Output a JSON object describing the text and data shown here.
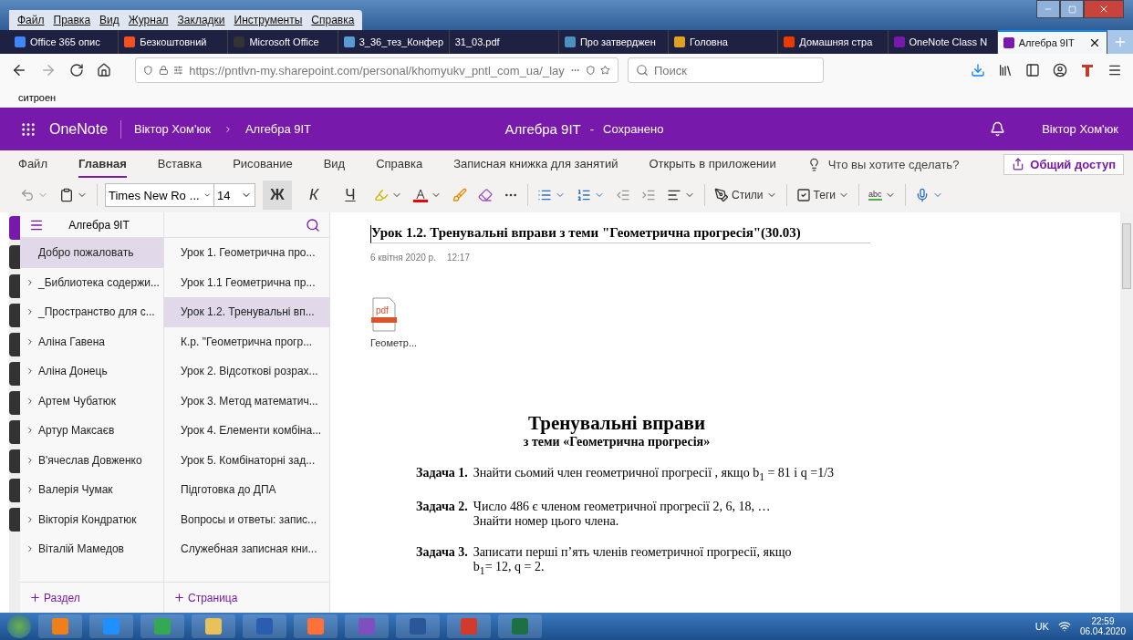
{
  "menu_bar": [
    "Файл",
    "Правка",
    "Вид",
    "Журнал",
    "Закладки",
    "Инструменты",
    "Справка"
  ],
  "browser_tabs": [
    {
      "title": "Office 365 опис",
      "selected": false,
      "color": "#4285f4"
    },
    {
      "title": "Безкоштовний",
      "selected": false,
      "color": "#f25022"
    },
    {
      "title": "Microsoft Office",
      "selected": false,
      "color": "#333333"
    },
    {
      "title": "3_36_тез_Конфер",
      "selected": false,
      "color": "#5b9bd5"
    },
    {
      "title": "31_03.pdf",
      "selected": false
    },
    {
      "title": "Про затверджен",
      "selected": false,
      "color": "#4a90c0"
    },
    {
      "title": "Головна",
      "selected": false,
      "color": "#e0a020"
    },
    {
      "title": "Домашняя стра",
      "selected": false,
      "color": "#eb3c00"
    },
    {
      "title": "OneNote Class N",
      "selected": false,
      "color": "#7719aa"
    },
    {
      "title": "Алгебра 9IT",
      "selected": true,
      "color": "#7719aa"
    }
  ],
  "address_bar": {
    "url": "https://pntlvn-my.sharepoint.com/personal/khomyukv_pntl_com_ua/_lay"
  },
  "search": {
    "placeholder": "Поиск"
  },
  "bookmarks": [
    "ситроен"
  ],
  "onenote_header": {
    "app": "OneNote",
    "breadcrumb": [
      "Віктор Хом'юк",
      "Алгебра 9IT"
    ],
    "notebook": "Алгебра 9IT",
    "separator": "-",
    "status": "Сохранено",
    "user": "Віктор Хом'юк"
  },
  "ribbon_tabs": [
    {
      "label": "Файл",
      "selected": false
    },
    {
      "label": "Главная",
      "selected": true
    },
    {
      "label": "Вставка",
      "selected": false
    },
    {
      "label": "Рисование",
      "selected": false
    },
    {
      "label": "Вид",
      "selected": false
    },
    {
      "label": "Справка",
      "selected": false
    },
    {
      "label": "Записная книжка для занятий",
      "selected": false
    },
    {
      "label": "Открыть в приложении",
      "selected": false
    }
  ],
  "tell_me": "Что вы хотите сделать?",
  "share_button": "Общий доступ",
  "toolbar": {
    "font": "Times New Ro",
    "font_ellipsis": "...",
    "size": "14",
    "bold": "Ж",
    "italic": "К",
    "underline": "Ч",
    "styles": "Стили",
    "tags": "Теги",
    "spell": "abc"
  },
  "sections_panel": {
    "title": "Алгебра 9IT",
    "add": "Раздел",
    "items": [
      {
        "label": "Добро пожаловать",
        "selected": true
      },
      {
        "label": "_Библиотека содержи...",
        "selected": false,
        "expanded": false
      },
      {
        "label": "_Пространство для с...",
        "selected": false,
        "expanded": false
      },
      {
        "label": "Аліна Гавена",
        "selected": false,
        "expanded": false
      },
      {
        "label": "Аліна Донець",
        "selected": false,
        "expanded": false
      },
      {
        "label": "Артем Чубатюк",
        "selected": false,
        "expanded": false
      },
      {
        "label": "Артур Максаєв",
        "selected": false,
        "expanded": false
      },
      {
        "label": "В'ячеслав Довженко",
        "selected": false,
        "expanded": false
      },
      {
        "label": "Валерія Чумак",
        "selected": false,
        "expanded": false
      },
      {
        "label": "Вікторія Кондратюк",
        "selected": false,
        "expanded": false
      },
      {
        "label": "Віталій Мамедов",
        "selected": false,
        "expanded": false
      }
    ]
  },
  "pages_panel": {
    "add": "Страница",
    "items": [
      {
        "label": "Урок 1. Геометрична про...",
        "selected": false
      },
      {
        "label": "Урок 1.1 Геометрична пр...",
        "selected": false
      },
      {
        "label": "Урок 1.2. Тренувальні вп...",
        "selected": true
      },
      {
        "label": "К.р. \"Геометрична прогр...",
        "selected": false
      },
      {
        "label": "Урок 2. Відсоткові розрах...",
        "selected": false
      },
      {
        "label": "Урок 3. Метод математич...",
        "selected": false
      },
      {
        "label": "Урок 4. Елементи комбіна...",
        "selected": false
      },
      {
        "label": "Урок 5. Комбінаторні зад...",
        "selected": false
      },
      {
        "label": "Підготовка до ДПА",
        "selected": false
      },
      {
        "label": "Вопросы и ответы: запис...",
        "selected": false
      },
      {
        "label": "Служебная записная кни...",
        "selected": false
      }
    ]
  },
  "page": {
    "title": "Урок 1.2. Тренувальні вправи з теми \"Геометрична прогресія\"(30.03)",
    "date": "6 квітня 2020 р.",
    "time": "12:17",
    "attachment": {
      "type": "pdf",
      "name": "Геометр..."
    },
    "heading": "Тренувальні вправи",
    "subheading": "з теми «Геометрична прогресія»",
    "tasks": [
      {
        "label": "Задача 1.",
        "lines": [
          "Знайти сьомий член геометричної прогресії , якщо b$_{1}$ = 81 і q =1/3"
        ]
      },
      {
        "label": "Задача 2.",
        "lines": [
          "Число 486 є членом геометричної прогресії  2, 6, 18, …",
          "Знайти номер цього члена."
        ]
      },
      {
        "label": "Задача 3.",
        "lines": [
          "Записати перші  п’ять членів геометричної  прогресії, якщо",
          "b$_{1}$= 12, q = 2."
        ]
      }
    ]
  },
  "taskbar": {
    "language": "UK",
    "time": "22:59",
    "date": "06.04.2020"
  }
}
